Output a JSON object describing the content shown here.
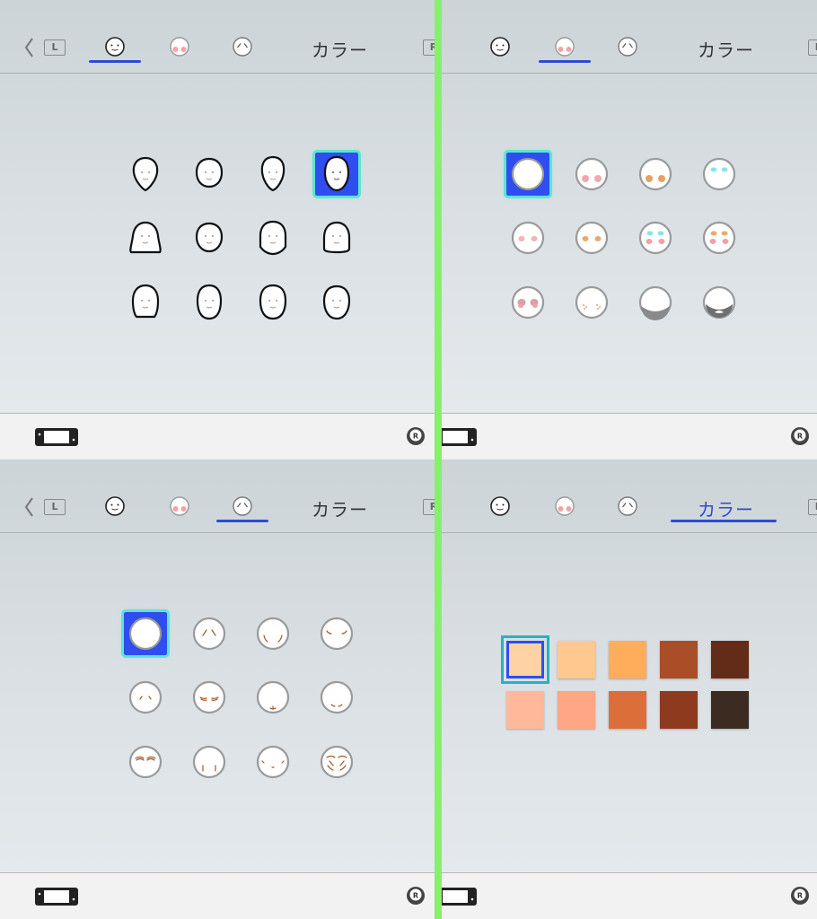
{
  "panels": [
    {
      "active_tab": 0,
      "color_label": "カラー",
      "show_back": true
    },
    {
      "active_tab": 1,
      "color_label": "カラー",
      "show_back": false
    },
    {
      "active_tab": 2,
      "color_label": "カラー",
      "show_back": true
    },
    {
      "active_tab": 3,
      "color_label": "カラー",
      "show_back": false
    }
  ],
  "buttons": {
    "l_label": "L",
    "r_label": "R",
    "r_stick_label": "R"
  },
  "face_shapes": {
    "rows": 3,
    "cols": 4,
    "selected_index": 3
  },
  "face_makeup": {
    "rows": 3,
    "cols": 4,
    "selected_index": 0,
    "items": [
      "none",
      "pink-cheeks",
      "orange-cheeks",
      "cyan-eyeshadow",
      "pink-small",
      "orange-small",
      "cyan-pink",
      "orange-pink",
      "mauve-blush",
      "freckles",
      "gray-chin",
      "beard"
    ]
  },
  "face_wrinkles": {
    "rows": 3,
    "cols": 4,
    "selected_index": 0,
    "items": [
      "none",
      "brow-lines",
      "cheek-lines",
      "eye-lines",
      "small-brow",
      "eyelids",
      "chin-dimple",
      "nasolabial",
      "brows-heavy",
      "mouth-lines",
      "side-lines",
      "full-wrinkles"
    ]
  },
  "skin_colors": {
    "selected_index": 0,
    "colors": [
      "#ffd2a6",
      "#ffc88f",
      "#ffad5a",
      "#a94e26",
      "#622c18",
      "#ffb99a",
      "#ffa684",
      "#dc6f39",
      "#8d3a1f",
      "#3b2b21"
    ]
  },
  "accent_color": "#2f49d6",
  "selection_fill": "#2f4df0",
  "selection_outline": "#5ce6d3",
  "divider_color": "#86f06a"
}
